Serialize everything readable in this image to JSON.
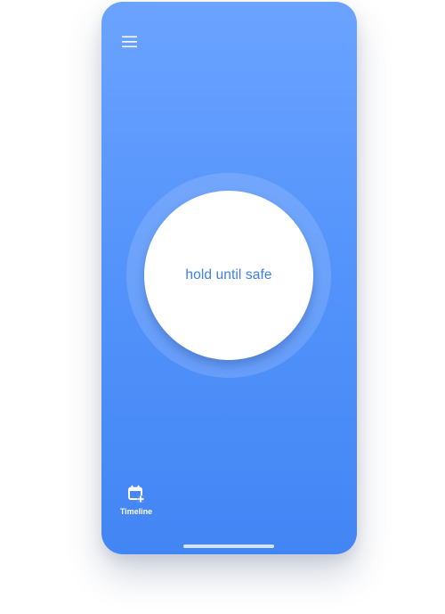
{
  "header": {
    "menu_icon": "hamburger-menu-icon"
  },
  "main": {
    "hold_button_label": "hold until safe"
  },
  "bottom_nav": {
    "timeline": {
      "icon": "calendar-add-icon",
      "label": "Timeline"
    }
  },
  "colors": {
    "gradient_top": "#6ba3ff",
    "gradient_bottom": "#4285f4",
    "accent_text": "#3f7fe6",
    "button_bg": "#ffffff"
  }
}
